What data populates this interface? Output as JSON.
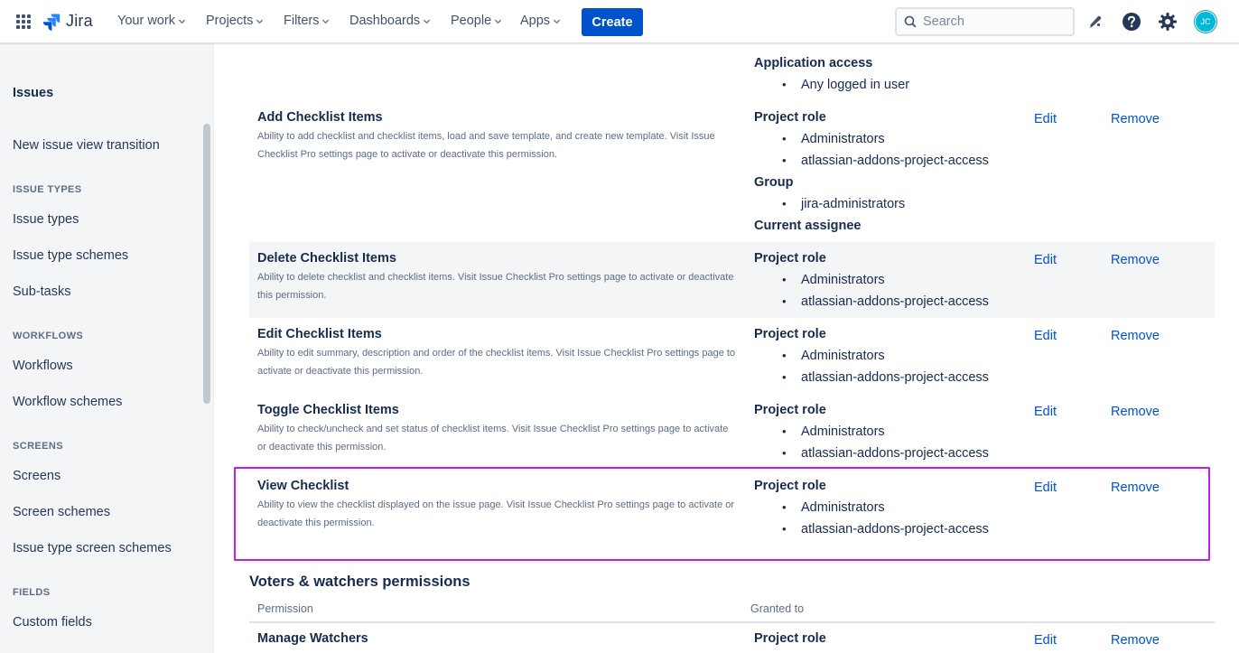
{
  "topnav": {
    "app_name": "Jira",
    "menu": [
      {
        "label": "Your work"
      },
      {
        "label": "Projects"
      },
      {
        "label": "Filters"
      },
      {
        "label": "Dashboards"
      },
      {
        "label": "People"
      },
      {
        "label": "Apps"
      }
    ],
    "create_label": "Create",
    "search_placeholder": "Search",
    "icons": [
      "app-switcher-icon",
      "jira-logo-icon",
      "notifications-icon",
      "help-icon",
      "settings-icon"
    ],
    "avatar_initials": "JC",
    "brand_color": "#0052cc"
  },
  "sidebar": {
    "title": "Issues",
    "top_link": "New issue view transition",
    "sections": [
      {
        "heading": "ISSUE TYPES",
        "items": [
          "Issue types",
          "Issue type schemes",
          "Sub-tasks"
        ]
      },
      {
        "heading": "WORKFLOWS",
        "items": [
          "Workflows",
          "Workflow schemes"
        ]
      },
      {
        "heading": "SCREENS",
        "items": [
          "Screens",
          "Screen schemes",
          "Issue type screen schemes"
        ]
      },
      {
        "heading": "FIELDS",
        "items": [
          "Custom fields"
        ]
      }
    ]
  },
  "main": {
    "partial_top": {
      "heading": "Application access",
      "item": "Any logged in user"
    },
    "actions": {
      "edit": "Edit",
      "remove": "Remove"
    },
    "permissions": [
      {
        "name": "Add Checklist Items",
        "description": "Ability to add checklist and checklist items, load and save template, and create new template. Visit Issue Checklist Pro settings page to activate or deactivate this permission.",
        "grants": [
          {
            "heading": "Project role",
            "items": [
              "Administrators",
              "atlassian-addons-project-access"
            ]
          },
          {
            "heading": "Group",
            "items": [
              "jira-administrators"
            ]
          },
          {
            "heading": "Current assignee",
            "items": []
          }
        ]
      },
      {
        "name": "Delete Checklist Items",
        "description": "Ability to delete checklist and checklist items. Visit Issue Checklist Pro settings page to activate or deactivate this permission.",
        "grants": [
          {
            "heading": "Project role",
            "items": [
              "Administrators",
              "atlassian-addons-project-access"
            ]
          }
        ]
      },
      {
        "name": "Edit Checklist Items",
        "description": "Ability to edit summary, description and order of the checklist items. Visit Issue Checklist Pro settings page to activate or deactivate this permission.",
        "grants": [
          {
            "heading": "Project role",
            "items": [
              "Administrators",
              "atlassian-addons-project-access"
            ]
          }
        ]
      },
      {
        "name": "Toggle Checklist Items",
        "description": "Ability to check/uncheck and set status of checklist items. Visit Issue Checklist Pro settings page to activate or deactivate this permission.",
        "grants": [
          {
            "heading": "Project role",
            "items": [
              "Administrators",
              "atlassian-addons-project-access"
            ]
          }
        ]
      },
      {
        "name": "View Checklist",
        "description": "Ability to view the checklist displayed on the issue page. Visit Issue Checklist Pro settings page to activate or deactivate this permission.",
        "grants": [
          {
            "heading": "Project role",
            "items": [
              "Administrators",
              "atlassian-addons-project-access"
            ]
          }
        ]
      }
    ],
    "voters_section": {
      "title": "Voters & watchers permissions",
      "col_permission": "Permission",
      "col_granted": "Granted to",
      "first_row": {
        "name": "Manage Watchers",
        "grant_heading": "Project role"
      }
    },
    "highlight_color": "#c21dea"
  }
}
